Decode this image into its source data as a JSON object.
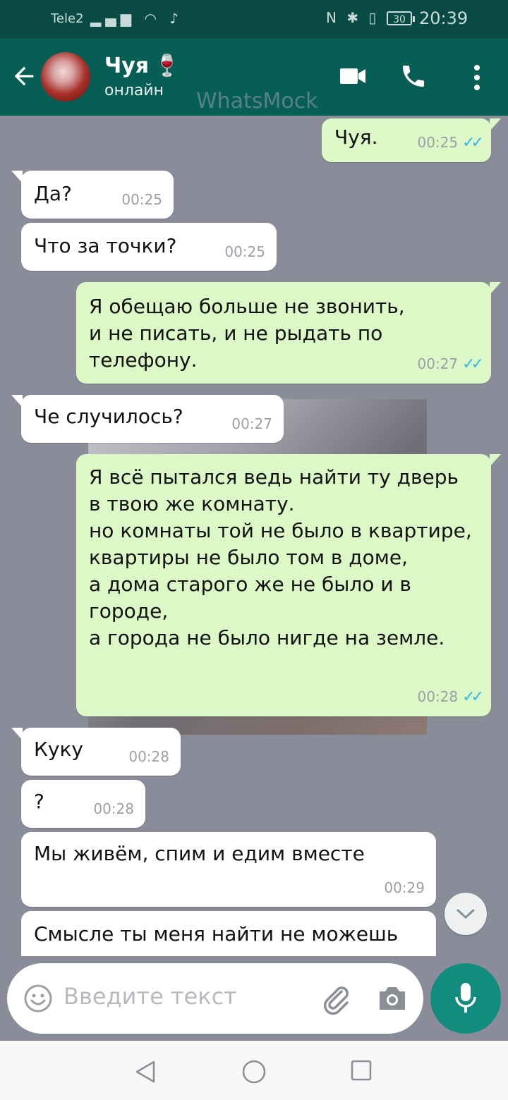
{
  "status_bar": {
    "carrier": "Tele2",
    "battery": "30",
    "time": "20:39"
  },
  "header": {
    "contact_name": "Чуя",
    "contact_emoji": "🍷",
    "status": "онлайн"
  },
  "watermark": "WhatsMock",
  "messages": [
    {
      "dir": "out",
      "text": "Чуя.",
      "time": "00:25",
      "read": true
    },
    {
      "dir": "in",
      "text": "Да?",
      "time": "00:25"
    },
    {
      "dir": "in",
      "text": "Что за точки?",
      "time": "00:25"
    },
    {
      "dir": "out",
      "text": "Я обещаю больше не звонить,\nи не писать, и не рыдать по\nтелефону.",
      "time": "00:27",
      "read": true
    },
    {
      "dir": "in",
      "text": "Че случилось?",
      "time": "00:27"
    },
    {
      "dir": "out",
      "text": "Я всё пытался ведь найти ту дверь\nв твою же комнату.\nно комнаты той не было в квартире,\nквартиры не было том в доме,\nа дома старого же не было и в\nгороде,\nа города не было нигде на земле.",
      "time": "00:28",
      "read": true
    },
    {
      "dir": "in",
      "text": "Куку",
      "time": "00:28"
    },
    {
      "dir": "in",
      "text": "?",
      "time": "00:28"
    },
    {
      "dir": "in",
      "text": "Мы живём, спим и едим вместе",
      "time": "00:29"
    },
    {
      "dir": "in",
      "text": "Смысле ты меня найти не можешь",
      "time": ""
    }
  ],
  "input": {
    "placeholder": "Введите текст"
  },
  "icons": {
    "back": "arrow-left-icon",
    "video": "video-camera-icon",
    "call": "phone-icon",
    "menu": "more-vert-icon",
    "emoji": "emoji-icon",
    "attach": "paperclip-icon",
    "camera": "camera-icon",
    "mic": "microphone-icon",
    "scroll": "chevron-down-icon"
  },
  "colors": {
    "header": "#075e54",
    "status_bar": "#0a4a45",
    "outgoing_bubble": "#dcf8c6",
    "incoming_bubble": "#ffffff",
    "read_ticks": "#34b7f1",
    "mic_button": "#128c7e",
    "chat_background": "#8a8c9a"
  }
}
